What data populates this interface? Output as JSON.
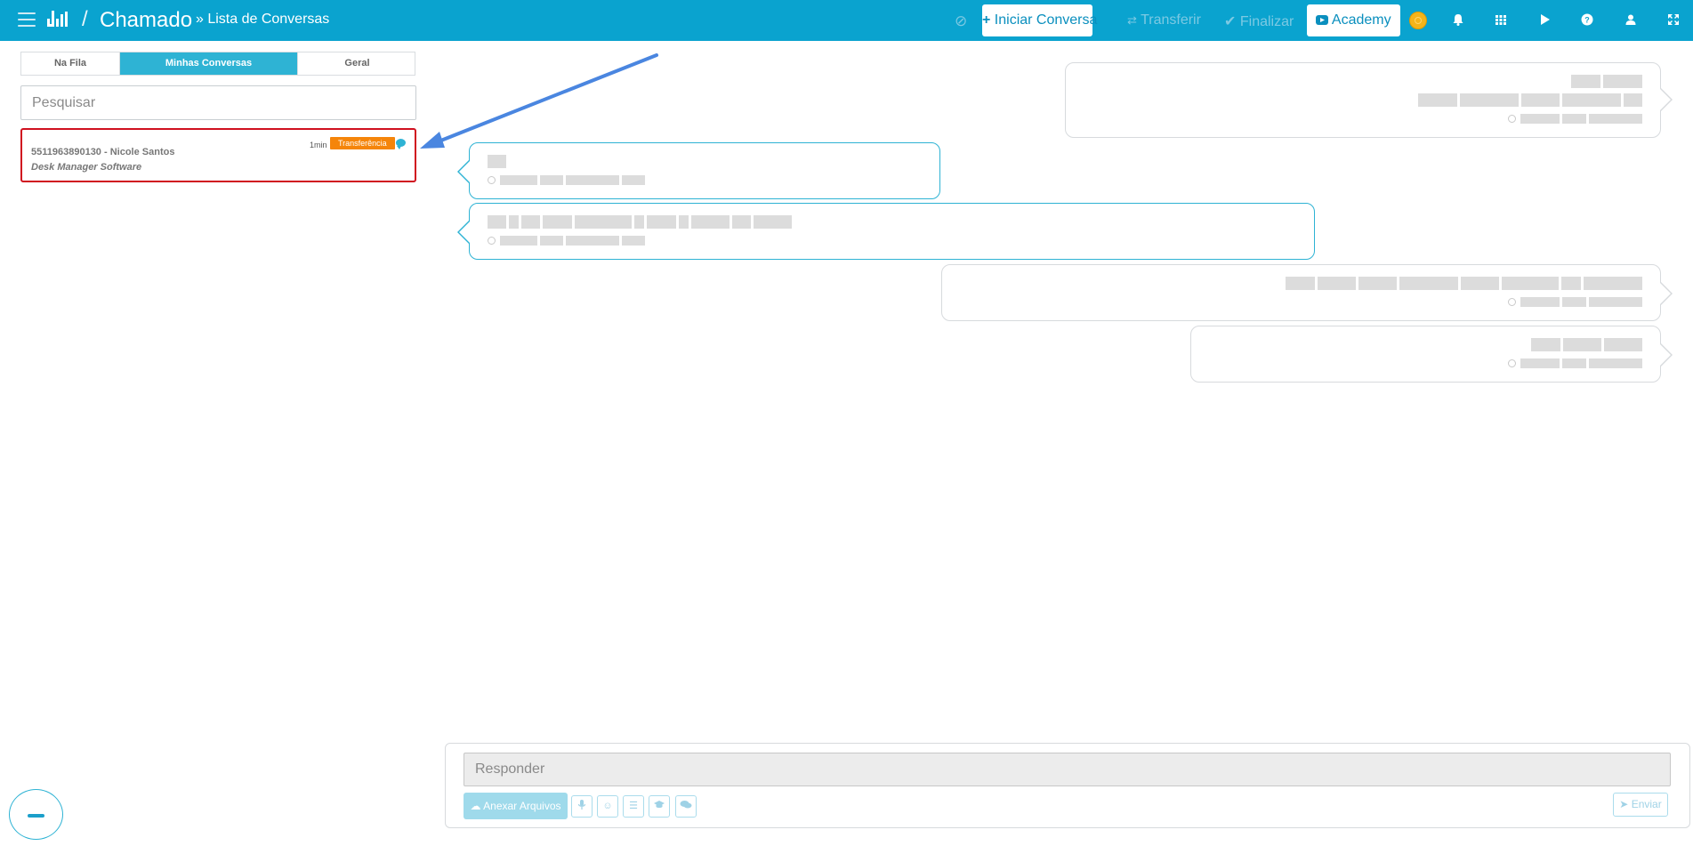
{
  "topbar": {
    "title_sep": "/",
    "title": "Chamado",
    "breadcrumb": "» Lista de Conversas",
    "iniciar_label": "Iniciar Conversa",
    "transferir_label": "Transferir",
    "finalizar_label": "Finalizar",
    "academy_label": "Academy"
  },
  "tabs": [
    "Na Fila",
    "Minhas Conversas",
    "Geral"
  ],
  "search": {
    "placeholder": "Pesquisar"
  },
  "conversation": {
    "name": "5511963890130 - Nicole Santos",
    "company": "Desk Manager Software",
    "time": "1min",
    "badge": "Transferência"
  },
  "reply": {
    "placeholder": "Responder",
    "attach_label": "Anexar Arquivos",
    "send_label": "Enviar"
  },
  "colors": {
    "primary": "#0aa3cf",
    "accent": "#2eb3d4",
    "badge": "#f5850a",
    "alert_border": "#d0101f",
    "arrow": "#4a86e0"
  },
  "icons": [
    "menu-icon",
    "logo-icon",
    "ban-icon",
    "plus-icon",
    "transfer-icon",
    "check-icon",
    "youtube-icon",
    "coin-icon",
    "bell-icon",
    "grid-icon",
    "play-icon",
    "help-icon",
    "user-icon",
    "expand-icon",
    "chat-icon",
    "clock-icon",
    "cloud-upload-icon",
    "mic-icon",
    "emoji-icon",
    "list-icon",
    "graduation-icon",
    "comments-icon",
    "send-icon",
    "minimize-icon"
  ]
}
